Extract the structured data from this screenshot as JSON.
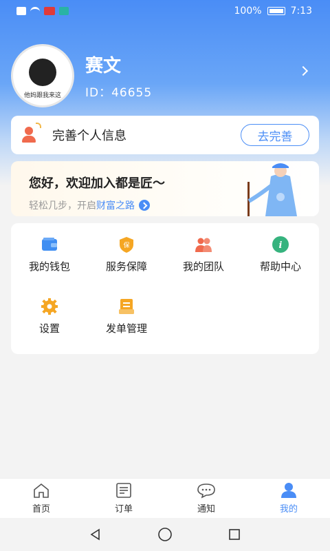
{
  "status_bar": {
    "battery": "100%",
    "time": "7:13"
  },
  "profile": {
    "name": "赛文",
    "id_label": "ID：46655",
    "avatar_caption": "他妈跟我来这"
  },
  "info_card": {
    "text": "完善个人信息",
    "button_label": "去完善"
  },
  "welcome": {
    "title": "您好，欢迎加入都是匠～",
    "sub_prefix": "轻松几步，开启",
    "sub_highlight": "财富之路"
  },
  "menu": {
    "items": [
      {
        "label": "我的钱包",
        "icon": "wallet-icon"
      },
      {
        "label": "服务保障",
        "icon": "shield-icon"
      },
      {
        "label": "我的团队",
        "icon": "team-icon"
      },
      {
        "label": "帮助中心",
        "icon": "help-icon"
      },
      {
        "label": "设置",
        "icon": "gear-icon"
      },
      {
        "label": "发单管理",
        "icon": "order-manage-icon"
      }
    ]
  },
  "tabbar": {
    "tabs": [
      {
        "label": "首页",
        "icon": "home-icon"
      },
      {
        "label": "订单",
        "icon": "orders-icon"
      },
      {
        "label": "通知",
        "icon": "chat-icon"
      },
      {
        "label": "我的",
        "icon": "profile-icon"
      }
    ],
    "active_index": 3
  },
  "colors": {
    "accent": "#4a8df6",
    "wallet": "#3f8ef2",
    "shield": "#f5a623",
    "team": "#f06a4d",
    "help": "#36b37e",
    "gear": "#f5a623",
    "order": "#f5a623"
  }
}
